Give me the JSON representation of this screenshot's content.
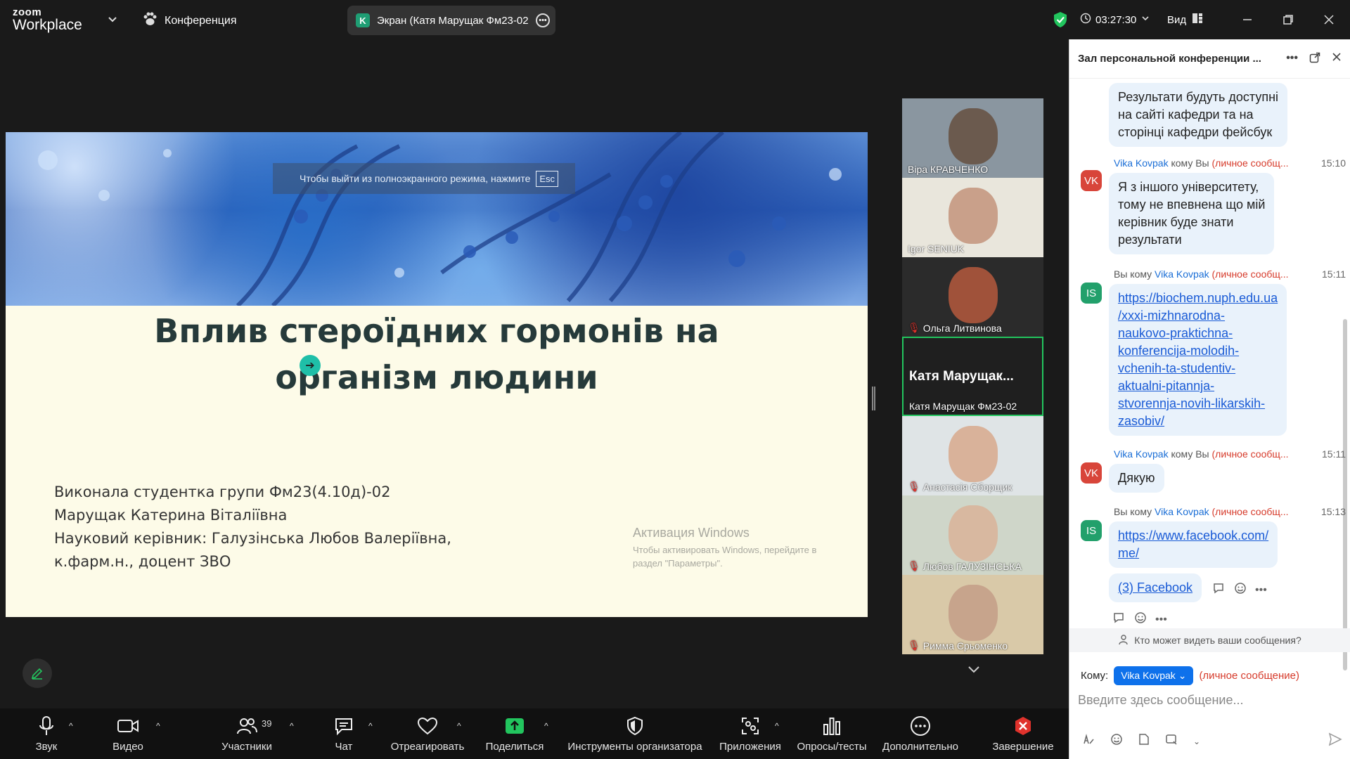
{
  "app": {
    "logo_line1": "zoom",
    "logo_line2": "Workplace",
    "conference_label": "Конференция",
    "screen_initial": "K",
    "screen_label": "Экран (Катя Марущак Фм23-02",
    "timer": "03:27:30",
    "view_label": "Вид",
    "accent": "#0e71eb",
    "secure_color": "#22c55e"
  },
  "slide": {
    "esc_hint": "Чтобы выйти из полноэкранного режима, нажмите",
    "esc_key": "Esc",
    "title_line1": "Вплив стероїдних гормонів на",
    "title_line2": "організм людини",
    "body": [
      "Виконала студентка групи Фм23(4.10д)-02",
      "Марущак Катерина Віталіївна",
      "Науковий керівник: Галузінська Любов Валеріївна,",
      "к.фарм.н., доцент ЗВО"
    ],
    "activation_title": "Активация Windows",
    "activation_line1": "Чтобы активировать Windows, перейдите в",
    "activation_line2": "раздел \"Параметры\"."
  },
  "participants": [
    {
      "name": "Віра КРАВЧЕНКО",
      "muted": false,
      "face": "#6b5a4e",
      "bg": "#8a96a0"
    },
    {
      "name": "Igor SENIUK",
      "muted": false,
      "face": "#c9a08a",
      "bg": "#e9e6dc"
    },
    {
      "name": "Ольга Литвинова",
      "muted": true,
      "face": "#a0523a",
      "bg": "#2b2b2b"
    },
    {
      "name": "Катя Марущак Фм23-02",
      "big": "Катя  Марущак...",
      "muted": false,
      "active": true
    },
    {
      "name": "Анастасія Сборщик",
      "muted": true,
      "face": "#d9b29a",
      "bg": "#dfe4e6"
    },
    {
      "name": "Любов ГАЛУЗІНСЬКА",
      "muted": true,
      "face": "#d8b8a0",
      "bg": "#cfd6c9"
    },
    {
      "name": "Римма Єрьоменко",
      "muted": true,
      "face": "#c7a48c",
      "bg": "#d9c9a8"
    }
  ],
  "toolbar": {
    "audio": "Звук",
    "video": "Видео",
    "participants": "Участники",
    "participants_count": "39",
    "chat": "Чат",
    "react": "Отреагировать",
    "share": "Поделиться",
    "host_tools": "Инструменты организатора",
    "apps": "Приложения",
    "polls": "Опросы/тесты",
    "more": "Дополнительно",
    "end": "Завершение"
  },
  "chat": {
    "title": "Зал персональной конференции ...",
    "messages": [
      {
        "text": [
          "Результати будуть доступні",
          "на сайті кафедри та на",
          "сторінці кафедри фейсбук"
        ]
      },
      {
        "meta_sender": "Vika Kovpak",
        "meta_to": "кому Вы",
        "meta_priv": "(личное сообщ...",
        "time": "15:10",
        "avatar": "VK",
        "text": [
          "Я з іншого університету,",
          "тому не впевнена що мій",
          "керівник буде знати",
          "результати"
        ]
      },
      {
        "meta_from": "Вы кому",
        "meta_sender": "Vika Kovpak",
        "meta_priv": "(личное сообщ...",
        "time": "15:11",
        "avatar": "IS",
        "link": [
          "https://biochem.nuph.edu.ua",
          "/xxxi-mizhnarodna-",
          "naukovo-praktichna-",
          "konferencija-molodih-",
          "vchenih-ta-studentiv-",
          "aktualni-pitannja-",
          "stvorennja-novih-likarskih-",
          "zasobiv/"
        ]
      },
      {
        "meta_sender": "Vika Kovpak",
        "meta_to": "кому Вы",
        "meta_priv": "(личное сообщ...",
        "time": "15:11",
        "avatar": "VK",
        "text": [
          "Дякую"
        ]
      },
      {
        "meta_from": "Вы кому",
        "meta_sender": "Vika Kovpak",
        "meta_priv": "(личное сообщ...",
        "time": "15:13",
        "avatar": "IS",
        "link": [
          "https://www.facebook.com/",
          "me/"
        ],
        "link2": "(3) Facebook"
      }
    ],
    "who_can_see": "Кто может видеть ваши сообщения?",
    "to_label": "Кому:",
    "to_value": "Vika Kovpak",
    "to_private": "(личное сообщение)",
    "placeholder": "Введите здесь сообщение..."
  }
}
